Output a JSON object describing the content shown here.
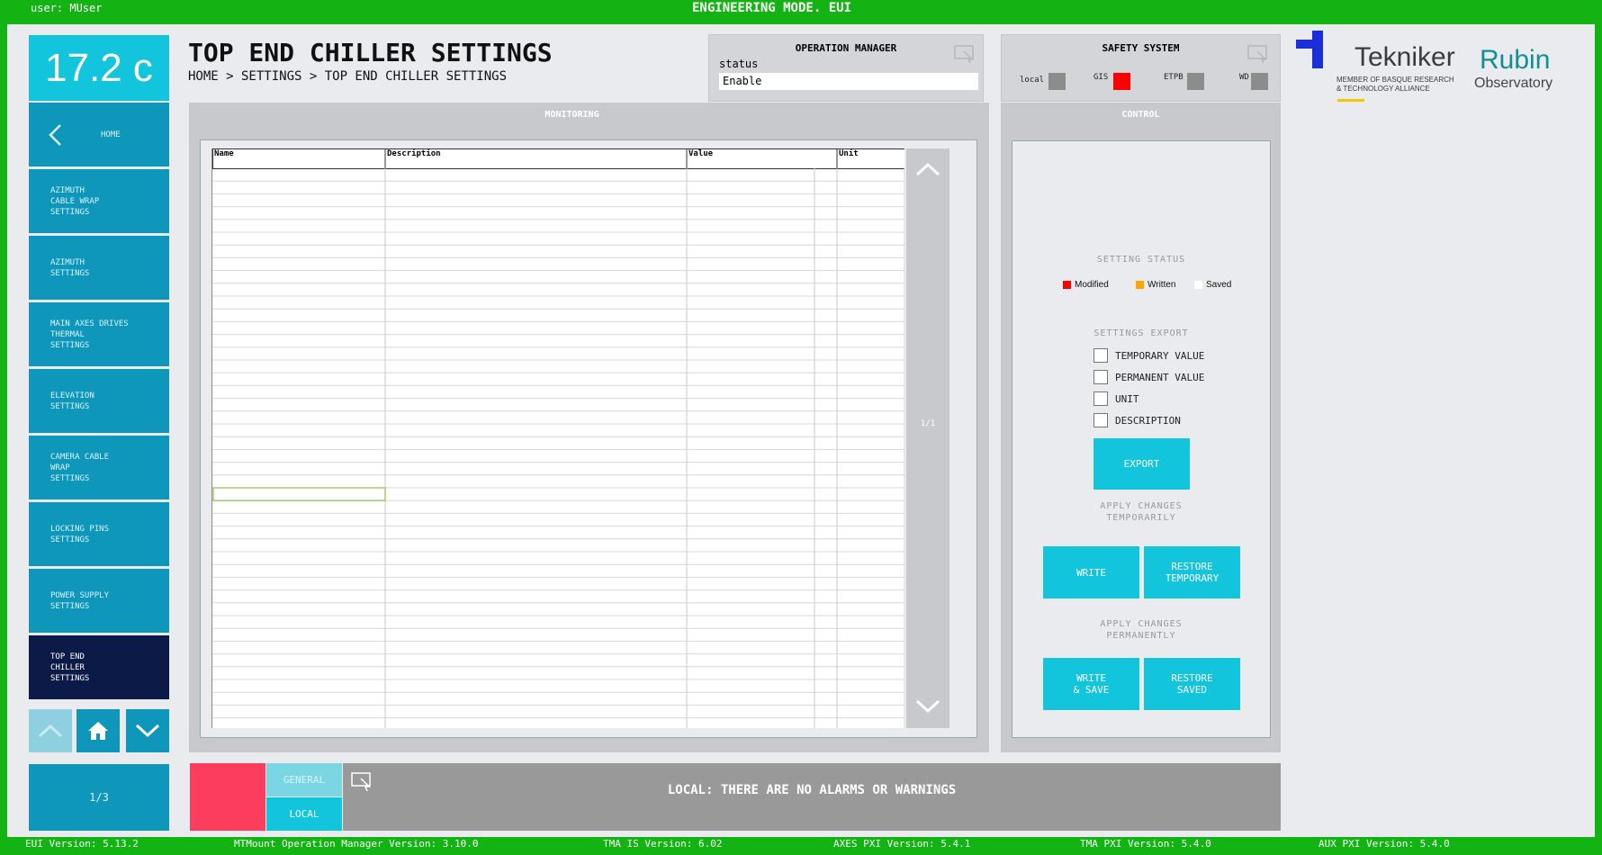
{
  "topbar": {
    "user": "user: MUser",
    "mode": "ENGINEERING MODE. EUI"
  },
  "temperature": "17.2 c",
  "sidebar": {
    "items": [
      {
        "label": "HOME"
      },
      {
        "label": "AZIMUTH\nCABLE WRAP\nSETTINGS"
      },
      {
        "label": "AZIMUTH\nSETTINGS"
      },
      {
        "label": "MAIN AXES DRIVES\nTHERMAL\nSETTINGS"
      },
      {
        "label": "ELEVATION\nSETTINGS"
      },
      {
        "label": "CAMERA CABLE\nWRAP\nSETTINGS"
      },
      {
        "label": "LOCKING PINS\nSETTINGS"
      },
      {
        "label": "POWER SUPPLY\nSETTINGS"
      },
      {
        "label": "TOP END\nCHILLER\nSETTINGS"
      }
    ],
    "page_indicator": "1/3"
  },
  "header": {
    "title": "TOP END CHILLER SETTINGS",
    "breadcrumb": "HOME > SETTINGS > TOP END CHILLER SETTINGS"
  },
  "operation_manager": {
    "title": "OPERATION MANAGER",
    "status_label": "status",
    "status_value": "Enable"
  },
  "safety_system": {
    "title": "SAFETY SYSTEM",
    "indicators": [
      {
        "label": "local",
        "color": "#8c8c8c"
      },
      {
        "label": "GIS",
        "color": "#ff0000"
      },
      {
        "label": "ETPB",
        "color": "#8c8c8c"
      },
      {
        "label": "WD",
        "color": "#8c8c8c"
      }
    ]
  },
  "monitoring": {
    "title": "MONITORING",
    "columns": [
      "Name",
      "Description",
      "Value",
      "Unit"
    ],
    "page": "1/1"
  },
  "control": {
    "title": "CONTROL",
    "setting_status_title": "SETTING STATUS",
    "legend": [
      {
        "label": "Modified",
        "color": "#ff0000"
      },
      {
        "label": "Written",
        "color": "#ffa500"
      },
      {
        "label": "Saved",
        "color": "#ffffff"
      }
    ],
    "export_title": "SETTINGS EXPORT",
    "export_options": [
      "TEMPORARY VALUE",
      "PERMANENT VALUE",
      "UNIT",
      "DESCRIPTION"
    ],
    "export_button": "EXPORT",
    "temp_title": "APPLY CHANGES\nTEMPORARILY",
    "write_button": "WRITE",
    "restore_temp_button": "RESTORE\nTEMPORARY",
    "perm_title": "APPLY CHANGES\nPERMANENTLY",
    "write_save_button": "WRITE\n& SAVE",
    "restore_saved_button": "RESTORE\nSAVED"
  },
  "alarms": {
    "general_label": "GENERAL",
    "local_label": "LOCAL",
    "message": "LOCAL: THERE ARE NO ALARMS OR WARNINGS"
  },
  "footer": {
    "versions": [
      "EUI Version: 5.13.2",
      "MTMount Operation Manager Version: 3.10.0",
      "TMA IS Version: 6.02",
      "AXES PXI Version: 5.4.1",
      "TMA PXI Version: 5.4.0",
      "AUX PXI Version: 5.4.0"
    ]
  },
  "logos": {
    "tekniker": "Tekniker",
    "tekniker_sub": "MEMBER OF BASQUE RESEARCH\n& TECHNOLOGY ALLIANCE",
    "rubin": "Rubin",
    "rubin_sub": "Observatory"
  }
}
